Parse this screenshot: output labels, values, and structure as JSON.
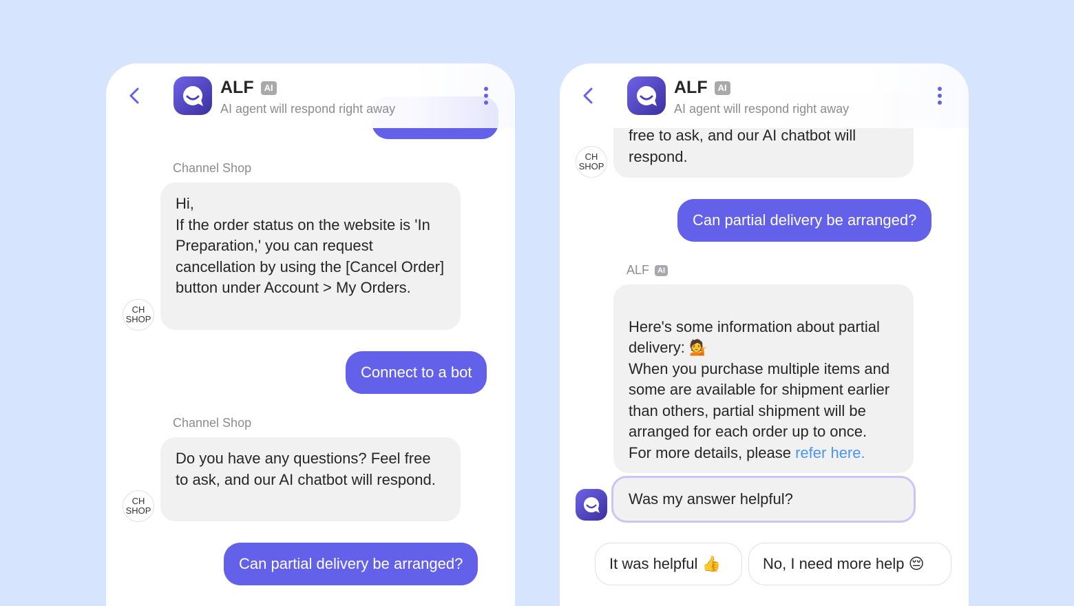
{
  "header": {
    "title": "ALF",
    "ai_badge": "AI",
    "subtitle": "AI agent will respond right away"
  },
  "left_chat": {
    "sender1": "Channel Shop",
    "message1": "Hi,\nIf the order status on the website is 'In Preparation,' you can request cancellation by using the [Cancel Order] button under Account > My Orders.",
    "user_message1": "Connect to a bot",
    "sender2": "Channel Shop",
    "message2": "Do you have any questions? Feel free to ask, and our AI chatbot will respond.",
    "user_message2": "Can partial delivery be arranged?"
  },
  "right_chat": {
    "message_top": "free to ask, and our AI chatbot will\nrespond.",
    "user_message": "Can partial delivery be arranged?",
    "sender": "ALF",
    "sender_badge": "AI",
    "answer_part1": "Here's some information about partial delivery: 💁\nWhen you purchase multiple items and some are available for shipment earlier than others, partial shipment will be arranged for each order up to once.\nFor more details, please ",
    "answer_link": "refer here.",
    "feedback_question": "Was my answer helpful?",
    "chip_helpful": "It was helpful 👍",
    "chip_more_help": "No, I need more help 😔"
  },
  "avatar_label": {
    "line1": "CH",
    "line2": "SHOP"
  },
  "colors": {
    "background": "#d7e4fd",
    "accent": "#6361ea",
    "link": "#4d94ee"
  }
}
